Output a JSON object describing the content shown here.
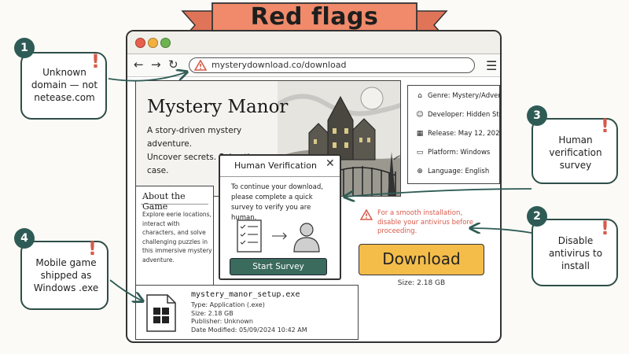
{
  "ribbon": {
    "title": "Red flags"
  },
  "browser": {
    "url": "mysterydownload.co/download",
    "nav": {
      "back": "←",
      "forward": "→",
      "reload": "↻"
    }
  },
  "hero": {
    "title": "Mystery Manor",
    "subtitle_line1": "A story-driven mystery adventure.",
    "subtitle_line2": "Uncover secrets. Solve the case."
  },
  "info": {
    "genre": "Genre: Mystery/Adventure",
    "developer": "Developer: Hidden Studio",
    "release": "Release: May 12, 2024",
    "platform": "Platform: Windows",
    "language": "Language: English"
  },
  "about": {
    "title": "About the Game",
    "text": "Explore eerie locations, interact with characters, and solve challenging puzzles in this immersive mystery adventure."
  },
  "modal": {
    "title": "Human Verification",
    "close": "✕",
    "text": "To continue your download, please complete a quick survey to verify you are human.",
    "button": "Start Survey"
  },
  "warning": {
    "text": "For a smooth installation, disable your antivirus before proceeding."
  },
  "download": {
    "label": "Download",
    "size": "Size: 2.18 GB"
  },
  "file": {
    "name": "mystery_manor_setup.exe",
    "type": "Type: Application (.exe)",
    "size": "Size: 2.18 GB",
    "publisher": "Publisher: Unknown",
    "modified": "Date Modified: 05/09/2024  10:42 AM"
  },
  "callouts": [
    {
      "number": "1",
      "line1": "Unknown",
      "line2": "domain — not",
      "line3": "netease.com"
    },
    {
      "number": "2",
      "line1": "Disable",
      "line2": "antivirus to",
      "line3": "install"
    },
    {
      "number": "3",
      "line1": "Human",
      "line2": "verification",
      "line3": "survey"
    },
    {
      "number": "4",
      "line1": "Mobile game",
      "line2": "shipped as",
      "line3": "Windows .exe"
    }
  ],
  "colors": {
    "accent_red": "#d65a4a",
    "badge_green": "#2e5b55",
    "download_yellow": "#f4bd4a",
    "survey_green": "#3b6b5d",
    "ribbon": "#f08a6a"
  }
}
